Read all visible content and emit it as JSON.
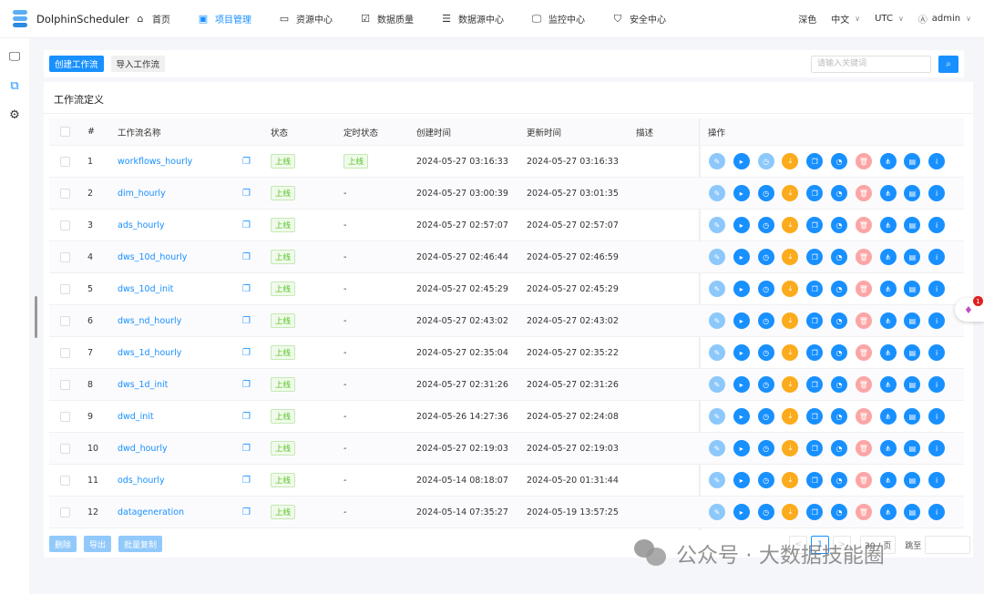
{
  "header": {
    "app_name": "DolphinScheduler",
    "nav": [
      {
        "label": "首页",
        "icon": "home-icon"
      },
      {
        "label": "项目管理",
        "icon": "project-icon",
        "active": true
      },
      {
        "label": "资源中心",
        "icon": "folder-icon"
      },
      {
        "label": "数据质量",
        "icon": "data-quality-icon"
      },
      {
        "label": "数据源中心",
        "icon": "datasource-icon"
      },
      {
        "label": "监控中心",
        "icon": "monitor-icon"
      },
      {
        "label": "安全中心",
        "icon": "shield-icon"
      }
    ],
    "theme": "深色",
    "language": "中文",
    "timezone": "UTC",
    "user": "admin"
  },
  "toolbar": {
    "create": "创建工作流",
    "import": "导入工作流",
    "search_placeholder": "请输入关键词"
  },
  "card": {
    "title": "工作流定义"
  },
  "table": {
    "columns": [
      "#",
      "工作流名称",
      "状态",
      "定时状态",
      "创建时间",
      "更新时间",
      "描述",
      "操作"
    ],
    "rows": [
      {
        "no": "1",
        "name": "workflows_hourly",
        "status": "上线",
        "timer": "上线",
        "created": "2024-05-27 03:16:33",
        "updated": "2024-05-27 03:16:33"
      },
      {
        "no": "2",
        "name": "dim_hourly",
        "status": "上线",
        "timer": "-",
        "created": "2024-05-27 03:00:39",
        "updated": "2024-05-27 03:01:35"
      },
      {
        "no": "3",
        "name": "ads_hourly",
        "status": "上线",
        "timer": "-",
        "created": "2024-05-27 02:57:07",
        "updated": "2024-05-27 02:57:07"
      },
      {
        "no": "4",
        "name": "dws_10d_hourly",
        "status": "上线",
        "timer": "-",
        "created": "2024-05-27 02:46:44",
        "updated": "2024-05-27 02:46:59"
      },
      {
        "no": "5",
        "name": "dws_10d_init",
        "status": "上线",
        "timer": "-",
        "created": "2024-05-27 02:45:29",
        "updated": "2024-05-27 02:45:29"
      },
      {
        "no": "6",
        "name": "dws_nd_hourly",
        "status": "上线",
        "timer": "-",
        "created": "2024-05-27 02:43:02",
        "updated": "2024-05-27 02:43:02"
      },
      {
        "no": "7",
        "name": "dws_1d_hourly",
        "status": "上线",
        "timer": "-",
        "created": "2024-05-27 02:35:04",
        "updated": "2024-05-27 02:35:22"
      },
      {
        "no": "8",
        "name": "dws_1d_init",
        "status": "上线",
        "timer": "-",
        "created": "2024-05-27 02:31:26",
        "updated": "2024-05-27 02:31:26"
      },
      {
        "no": "9",
        "name": "dwd_init",
        "status": "上线",
        "timer": "-",
        "created": "2024-05-26 14:27:36",
        "updated": "2024-05-27 02:24:08"
      },
      {
        "no": "10",
        "name": "dwd_hourly",
        "status": "上线",
        "timer": "-",
        "created": "2024-05-27 02:19:03",
        "updated": "2024-05-27 02:19:03"
      },
      {
        "no": "11",
        "name": "ods_hourly",
        "status": "上线",
        "timer": "-",
        "created": "2024-05-14 08:18:07",
        "updated": "2024-05-20 01:31:44"
      },
      {
        "no": "12",
        "name": "datageneration",
        "status": "上线",
        "timer": "-",
        "created": "2024-05-14 07:35:27",
        "updated": "2024-05-19 13:57:25"
      }
    ],
    "actions": [
      {
        "icon": "edit-icon",
        "color": "#8cc8fb"
      },
      {
        "icon": "run-icon",
        "color": "#1890ff"
      },
      {
        "icon": "timing-icon",
        "color": "#1890ff"
      },
      {
        "icon": "download-icon",
        "color": "#fcab1c"
      },
      {
        "icon": "copy-icon",
        "color": "#1890ff"
      },
      {
        "icon": "cron-manage-icon",
        "color": "#1890ff"
      },
      {
        "icon": "delete-icon",
        "color": "#fca5a5"
      },
      {
        "icon": "tree-icon",
        "color": "#1890ff"
      },
      {
        "icon": "version-icon",
        "color": "#1890ff"
      },
      {
        "icon": "info-icon",
        "color": "#1890ff"
      }
    ]
  },
  "footer": {
    "delete": "删除",
    "export": "导出",
    "batch_copy": "批量复制"
  },
  "pagination": {
    "prev": "<",
    "current": "1",
    "next": ">",
    "page_size": "30 / 页",
    "jump": "跳至"
  },
  "watermark": "公众号 · 大数据技能圈",
  "float_badge": "1"
}
